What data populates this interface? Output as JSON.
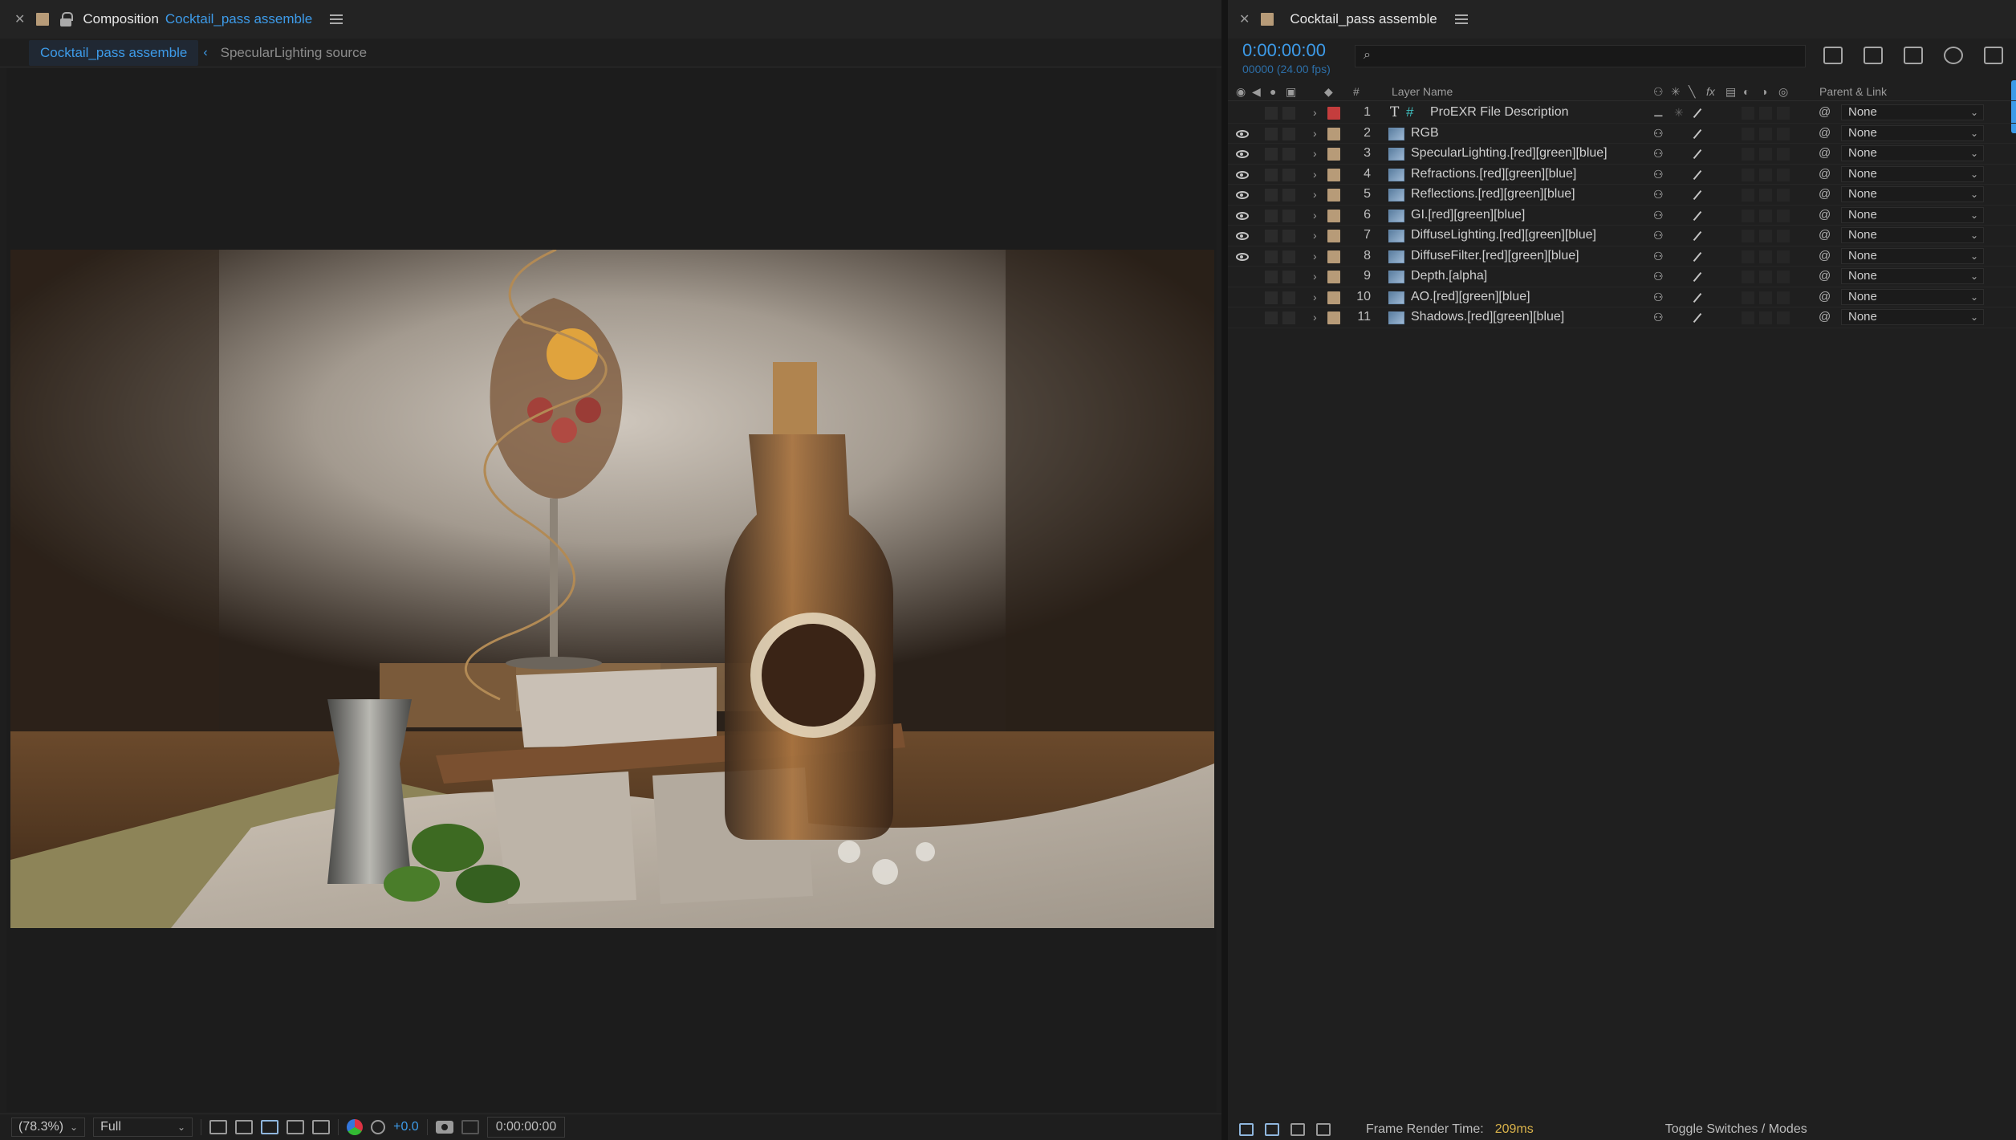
{
  "composition_panel": {
    "tab_kind": "Composition",
    "tab_name": "Cocktail_pass assemble",
    "breadcrumbs": [
      "Cocktail_pass assemble",
      "SpecularLighting source"
    ]
  },
  "status_bar": {
    "zoom": "(78.3%)",
    "resolution": "Full",
    "exposure": "+0.0",
    "timecode": "0:00:00:00"
  },
  "timeline": {
    "tab_name": "Cocktail_pass assemble",
    "timecode": "0:00:00:00",
    "frame_info": "00000 (24.00 fps)",
    "search_placeholder": "",
    "columns": {
      "number": "#",
      "layer_name": "Layer Name",
      "fx": "fx",
      "parent": "Parent & Link"
    },
    "layers": [
      {
        "num": "1",
        "name": "ProEXR File Description",
        "type": "text",
        "visible": false,
        "label_color": "#c43d3d",
        "parent": "None"
      },
      {
        "num": "2",
        "name": "RGB",
        "type": "footage",
        "visible": true,
        "label_color": "#b79b78",
        "parent": "None"
      },
      {
        "num": "3",
        "name": "SpecularLighting.[red][green][blue]",
        "type": "footage",
        "visible": true,
        "label_color": "#b79b78",
        "parent": "None"
      },
      {
        "num": "4",
        "name": "Refractions.[red][green][blue]",
        "type": "footage",
        "visible": true,
        "label_color": "#b79b78",
        "parent": "None"
      },
      {
        "num": "5",
        "name": "Reflections.[red][green][blue]",
        "type": "footage",
        "visible": true,
        "label_color": "#b79b78",
        "parent": "None"
      },
      {
        "num": "6",
        "name": "GI.[red][green][blue]",
        "type": "footage",
        "visible": true,
        "label_color": "#b79b78",
        "parent": "None"
      },
      {
        "num": "7",
        "name": "DiffuseLighting.[red][green][blue]",
        "type": "footage",
        "visible": true,
        "label_color": "#b79b78",
        "parent": "None"
      },
      {
        "num": "8",
        "name": "DiffuseFilter.[red][green][blue]",
        "type": "footage",
        "visible": true,
        "label_color": "#b79b78",
        "parent": "None"
      },
      {
        "num": "9",
        "name": "Depth.[alpha]",
        "type": "footage",
        "visible": false,
        "label_color": "#b79b78",
        "parent": "None"
      },
      {
        "num": "10",
        "name": "AO.[red][green][blue]",
        "type": "footage",
        "visible": false,
        "label_color": "#b79b78",
        "parent": "None"
      },
      {
        "num": "11",
        "name": "Shadows.[red][green][blue]",
        "type": "footage",
        "visible": false,
        "label_color": "#b79b78",
        "parent": "None"
      }
    ],
    "frame_render_label": "Frame Render Time:",
    "frame_render_value": "209ms",
    "toggle_label": "Toggle Switches / Modes"
  },
  "colors": {
    "accent": "#3d9be9",
    "render_time": "#d9b24a"
  }
}
